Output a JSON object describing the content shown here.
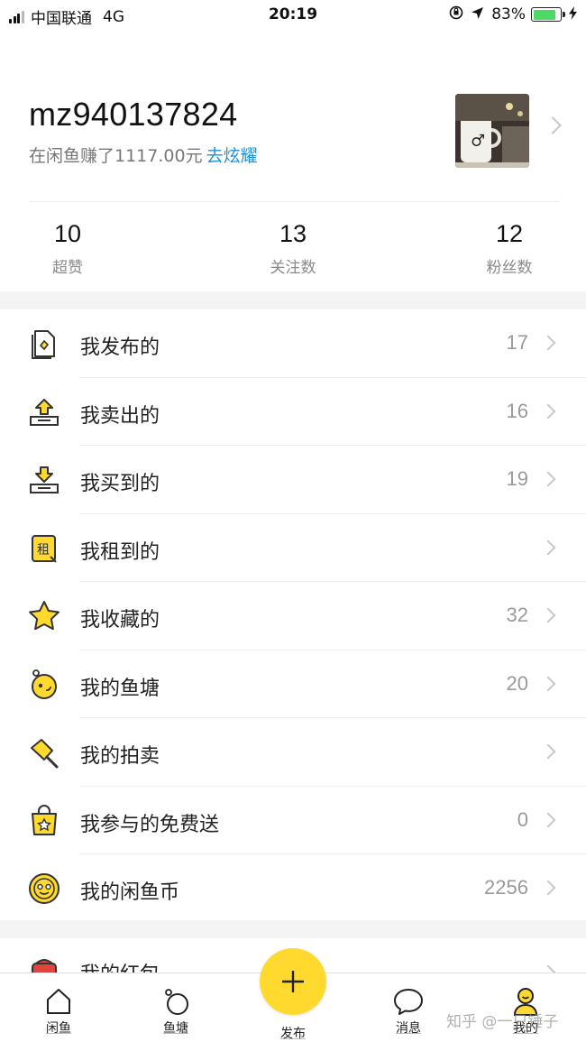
{
  "status_bar": {
    "carrier": "中国联通",
    "network": "4G",
    "time": "20:19",
    "battery": "83%"
  },
  "profile": {
    "username": "mz940137824",
    "earned_text": "在闲鱼赚了1117.00元",
    "brag_link": "去炫耀"
  },
  "stats": [
    {
      "value": "10",
      "label": "超赞"
    },
    {
      "value": "13",
      "label": "关注数"
    },
    {
      "value": "12",
      "label": "粉丝数"
    }
  ],
  "menu": [
    {
      "label": "我发布的",
      "count": "17",
      "icon": "published-doc-icon"
    },
    {
      "label": "我卖出的",
      "count": "16",
      "icon": "sold-tray-icon"
    },
    {
      "label": "我买到的",
      "count": "19",
      "icon": "bought-tray-icon"
    },
    {
      "label": "我租到的",
      "count": "",
      "icon": "rent-tag-icon"
    },
    {
      "label": "我收藏的",
      "count": "32",
      "icon": "star-icon"
    },
    {
      "label": "我的鱼塘",
      "count": "20",
      "icon": "fishpond-icon"
    },
    {
      "label": "我的拍卖",
      "count": "",
      "icon": "auction-hammer-icon"
    },
    {
      "label": "我参与的免费送",
      "count": "0",
      "icon": "gift-bag-icon"
    },
    {
      "label": "我的闲鱼币",
      "count": "2256",
      "icon": "coin-icon"
    }
  ],
  "partial_row": {
    "label": "我的红包"
  },
  "tabs": {
    "home": "闲鱼",
    "pond": "鱼塘",
    "publish": "发布",
    "messages": "消息",
    "mine": "我的"
  },
  "watermark": "知乎 @一只锤子",
  "colors": {
    "accent_yellow": "#ffd92e",
    "link_blue": "#1e90d6",
    "battery_green": "#4cd964"
  }
}
